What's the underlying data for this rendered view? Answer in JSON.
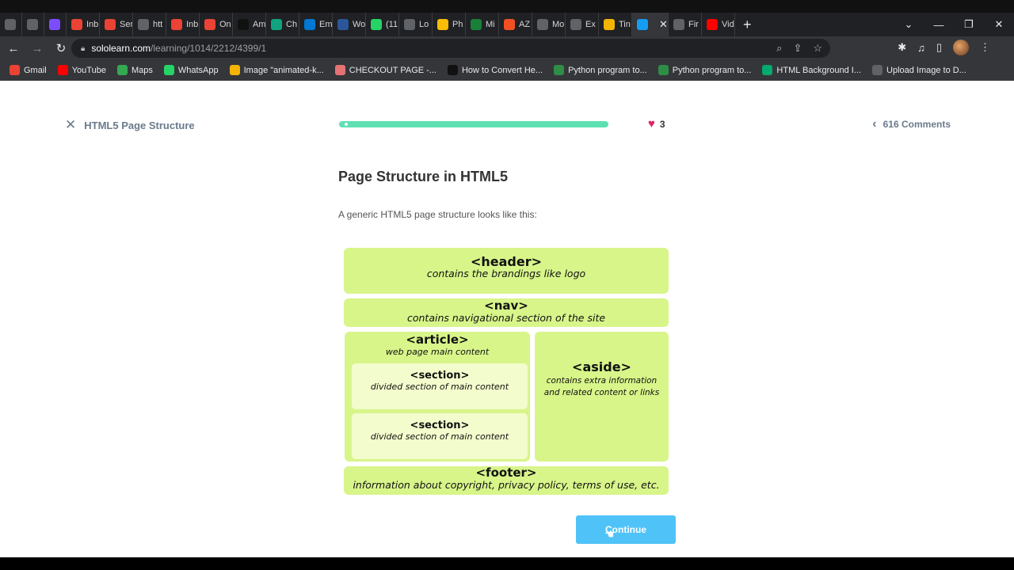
{
  "browser": {
    "tabs": [
      {
        "label": "",
        "icon": "app-icon",
        "color": "#5f6368"
      },
      {
        "label": "",
        "icon": "google-icon",
        "color": "#5f6368"
      },
      {
        "label": "",
        "icon": "extension-icon",
        "color": "#7c4dff"
      },
      {
        "label": "Inb",
        "icon": "gmail-icon",
        "color": "#ea4335"
      },
      {
        "label": "Ser",
        "icon": "gmail-icon",
        "color": "#ea4335"
      },
      {
        "label": "htt",
        "icon": "globe-icon",
        "color": "#5f6368"
      },
      {
        "label": "Inb",
        "icon": "gmail-icon",
        "color": "#ea4335"
      },
      {
        "label": "On",
        "icon": "gmail-icon",
        "color": "#ea4335"
      },
      {
        "label": "Am",
        "icon": "amazon-icon",
        "color": "#111111"
      },
      {
        "label": "Ch",
        "icon": "chatgpt-icon",
        "color": "#10a37f"
      },
      {
        "label": "Em",
        "icon": "outlook-icon",
        "color": "#0078d4"
      },
      {
        "label": "Wo",
        "icon": "word-icon",
        "color": "#2b579a"
      },
      {
        "label": "(11",
        "icon": "whatsapp-icon",
        "color": "#25d366"
      },
      {
        "label": "Lo",
        "icon": "globe-icon",
        "color": "#5f6368"
      },
      {
        "label": "Ph",
        "icon": "drive-icon",
        "color": "#fbbc04"
      },
      {
        "label": "Mi",
        "icon": "sheet-icon",
        "color": "#188038"
      },
      {
        "label": "AZ",
        "icon": "microsoft-icon",
        "color": "#f25022"
      },
      {
        "label": "Mo",
        "icon": "app-icon",
        "color": "#5f6368"
      },
      {
        "label": "Ex",
        "icon": "app-icon",
        "color": "#5f6368"
      },
      {
        "label": "Tin",
        "icon": "tinkercad-icon",
        "color": "#f4b400"
      },
      {
        "label": "",
        "icon": "sololearn-icon",
        "color": "#149ef2",
        "active": true
      },
      {
        "label": "Fir",
        "icon": "doc-icon",
        "color": "#5f6368"
      },
      {
        "label": "Vid",
        "icon": "youtube-icon",
        "color": "#ff0000"
      }
    ],
    "new_tab": "+",
    "url_host": "sololearn.com",
    "url_path": "/learning/1014/2212/4399/1",
    "bookmarks": [
      {
        "label": "Gmail",
        "icon": "gmail-icon",
        "color": "#ea4335"
      },
      {
        "label": "YouTube",
        "icon": "youtube-icon",
        "color": "#ff0000"
      },
      {
        "label": "Maps",
        "icon": "maps-icon",
        "color": "#34a853"
      },
      {
        "label": "WhatsApp",
        "icon": "whatsapp-icon",
        "color": "#25d366"
      },
      {
        "label": "Image \"animated-k...",
        "icon": "star-icon",
        "color": "#f4b400"
      },
      {
        "label": "CHECKOUT PAGE -...",
        "icon": "shoe-icon",
        "color": "#e57373"
      },
      {
        "label": "How to Convert He...",
        "icon": "alpha-icon",
        "color": "#111111"
      },
      {
        "label": "Python program to...",
        "icon": "gfg-icon",
        "color": "#2f8d46"
      },
      {
        "label": "Python program to...",
        "icon": "gfg-icon",
        "color": "#2f8d46"
      },
      {
        "label": "HTML Background I...",
        "icon": "w3-icon",
        "color": "#04aa6d"
      },
      {
        "label": "Upload Image to D...",
        "icon": "globe-icon",
        "color": "#5f6368"
      }
    ]
  },
  "lesson": {
    "course_title": "HTML5 Page Structure",
    "progress": 0.02,
    "likes": "3",
    "comments": "616 Comments",
    "title": "Page Structure in HTML5",
    "intro": "A generic HTML5 page structure looks like this:",
    "continue_label": "Continue"
  },
  "diagram": {
    "header": {
      "tag": "<header>",
      "desc": "contains the brandings like logo"
    },
    "nav": {
      "tag": "<nav>",
      "desc": "contains navigational section of the site"
    },
    "article": {
      "tag": "<article>",
      "desc": "web page main content"
    },
    "section1": {
      "tag": "<section>",
      "desc": "divided section of main content"
    },
    "section2": {
      "tag": "<section>",
      "desc": "divided section of main content"
    },
    "aside": {
      "tag": "<aside>",
      "desc": "contains extra information and related content or links"
    },
    "footer": {
      "tag": "<footer>",
      "desc": "information about copyright, privacy policy, terms of use, etc."
    },
    "colors": {
      "block": "#d8f58a",
      "section": "#f3fccc"
    }
  },
  "colors": {
    "progress": "#5ee0b3",
    "continue": "#4fc3f7",
    "heart": "#e0245e"
  }
}
